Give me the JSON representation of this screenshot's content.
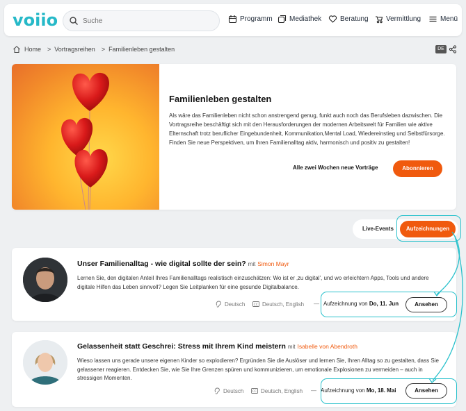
{
  "header": {
    "logo": "voiio",
    "search_placeholder": "Suche",
    "nav": [
      {
        "label": "Programm",
        "icon": "calendar-icon"
      },
      {
        "label": "Mediathek",
        "icon": "media-icon"
      },
      {
        "label": "Beratung",
        "icon": "heart-hand-icon"
      },
      {
        "label": "Vermittlung",
        "icon": "stroller-icon"
      },
      {
        "label": "Menü",
        "icon": "hamburger-icon"
      }
    ]
  },
  "breadcrumb": {
    "home": "Home",
    "items": [
      "Vortragsreihen",
      "Familienleben gestalten"
    ],
    "separator": ">"
  },
  "lang": "DE",
  "hero": {
    "title": "Familienleben gestalten",
    "description": "Als wäre das Familienleben nicht schon anstrengend genug, funkt auch noch das Berufsleben dazwischen. Die Vortragsreihe beschäftigt sich mit den Herausforderungen der modernen Arbeitswelt für Familien wie aktive Elternschaft trotz beruflicher Eingebundenheit, Kommunikation,Mental Load, Wiedereinstieg und Selbstfürsorge. Finden Sie neue Perspektiven, um Ihren Familienalltag aktiv, harmonisch und positiv zu gestalten!",
    "note": "Alle zwei Wochen neue Vorträge",
    "subscribe": "Abonnieren"
  },
  "toggle": {
    "live": "Live-Events",
    "recordings": "Aufzeichnungen"
  },
  "events": [
    {
      "title": "Unser Familienalltag - wie digital sollte der sein?",
      "mit": "mit",
      "speaker": "Simon Mayr",
      "description": "Lernen Sie, den digitalen Anteil Ihres Familienalltags realistisch einzuschätzen: Wo ist er ‚zu digital', und wo erleichtern Apps, Tools und andere digitale Hilfen das Leben sinnvoll? Legen Sie Leitplanken für eine gesunde Digitalbalance.",
      "audio_lang": "Deutsch",
      "subtitle_lang": "Deutsch, English",
      "dash": "—",
      "rec_prefix": "Aufzeichnung von",
      "rec_date": "Do, 11. Jun",
      "button": "Ansehen"
    },
    {
      "title": "Gelassenheit statt Geschrei: Stress mit Ihrem Kind meistern",
      "mit": "mit",
      "speaker": "Isabelle von Abendroth",
      "description": "Wieso lassen uns gerade unsere eigenen Kinder so explodieren? Ergründen Sie die Auslöser und lernen Sie, Ihren Alltag so zu gestalten, dass Sie gelassener reagieren. Entdecken Sie, wie Sie Ihre Grenzen spüren und kommunizieren, um emotionale Explosionen zu vermeiden – auch in stressigen Momenten.",
      "audio_lang": "Deutsch",
      "subtitle_lang": "Deutsch, English",
      "dash": "—",
      "rec_prefix": "Aufzeichnung von",
      "rec_date": "Mo, 18. Mai",
      "button": "Ansehen"
    }
  ],
  "colors": {
    "brand": "#26b9c8",
    "accent": "#f05a0e",
    "highlight": "#29c1cc"
  }
}
